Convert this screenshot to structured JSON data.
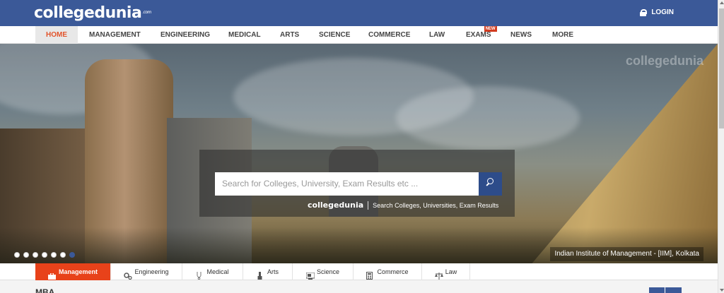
{
  "header": {
    "logo_text": "collegedunia",
    "logo_suffix": ".com",
    "login_label": "LOGIN"
  },
  "nav": {
    "items": [
      {
        "label": "HOME",
        "active": true
      },
      {
        "label": "MANAGEMENT"
      },
      {
        "label": "ENGINEERING"
      },
      {
        "label": "MEDICAL"
      },
      {
        "label": "ARTS"
      },
      {
        "label": "SCIENCE"
      },
      {
        "label": "COMMERCE"
      },
      {
        "label": "LAW"
      },
      {
        "label": "EXAMS",
        "badge": "NEW"
      },
      {
        "label": "NEWS"
      },
      {
        "label": "MORE"
      }
    ]
  },
  "hero": {
    "watermark": "collegedunia",
    "search": {
      "placeholder": "Search for Colleges, University, Exam Results etc ..."
    },
    "tagline_logo": "collegedunia",
    "tagline_text": "Search Colleges, Universities, Exam Results",
    "caption": "Indian Institute of Management - [IIM], Kolkata",
    "slide_count": 7,
    "current_slide": 7
  },
  "categories": {
    "tabs": [
      {
        "label": "Management",
        "icon": "briefcase-icon",
        "active": true
      },
      {
        "label": "Engineering",
        "icon": "gears-icon"
      },
      {
        "label": "Medical",
        "icon": "stethoscope-icon"
      },
      {
        "label": "Arts",
        "icon": "brush-icon"
      },
      {
        "label": "Science",
        "icon": "microscope-icon"
      },
      {
        "label": "Commerce",
        "icon": "calculator-icon"
      },
      {
        "label": "Law",
        "icon": "scales-icon"
      }
    ]
  },
  "section": {
    "title": "MBA"
  },
  "colors": {
    "brand_blue": "#3b5998",
    "accent_orange": "#e8421a",
    "search_button": "#2d4c8a"
  }
}
